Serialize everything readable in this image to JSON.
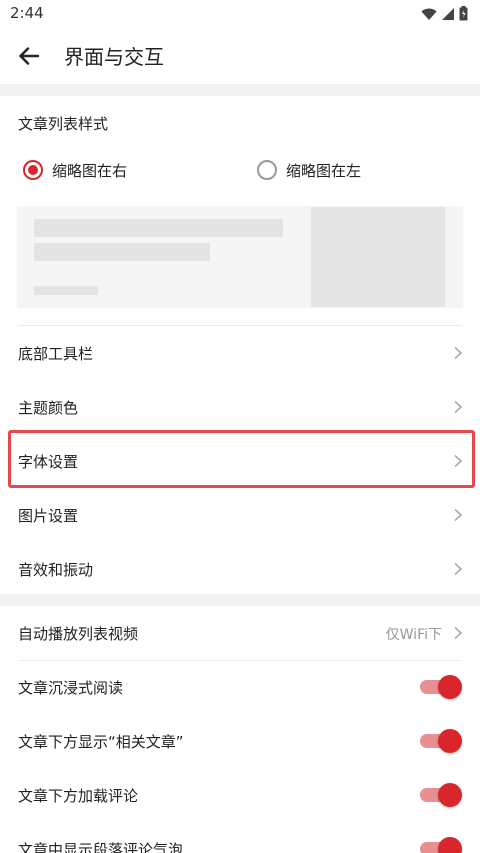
{
  "status_bar": {
    "time": "2:44",
    "icons": [
      "wifi-icon",
      "signal-icon",
      "battery-icon"
    ]
  },
  "header": {
    "back_icon": "arrow-left-icon",
    "title": "界面与交互"
  },
  "list_style": {
    "title": "文章列表样式",
    "options": [
      {
        "label": "缩略图在右",
        "selected": true
      },
      {
        "label": "缩略图在左",
        "selected": false
      }
    ]
  },
  "settings_group_1": [
    {
      "label": "底部工具栏"
    },
    {
      "label": "主题颜色"
    },
    {
      "label": "字体设置",
      "highlighted": true
    },
    {
      "label": "图片设置"
    },
    {
      "label": "音效和振动"
    }
  ],
  "settings_group_2": {
    "autoplay": {
      "label": "自动播放列表视频",
      "value": "仅WiFi下"
    },
    "toggles": [
      {
        "label": "文章沉浸式阅读",
        "on": true
      },
      {
        "label": "文章下方显示“相关文章”",
        "on": true
      },
      {
        "label": "文章下方加载评论",
        "on": true
      },
      {
        "label": "文章中显示段落评论气泡",
        "on": true
      }
    ]
  },
  "colors": {
    "accent": "#d9262b",
    "toggle_track": "#e88f91",
    "highlight_border": "#e5484d",
    "section_gap": "#f2f2f2"
  }
}
